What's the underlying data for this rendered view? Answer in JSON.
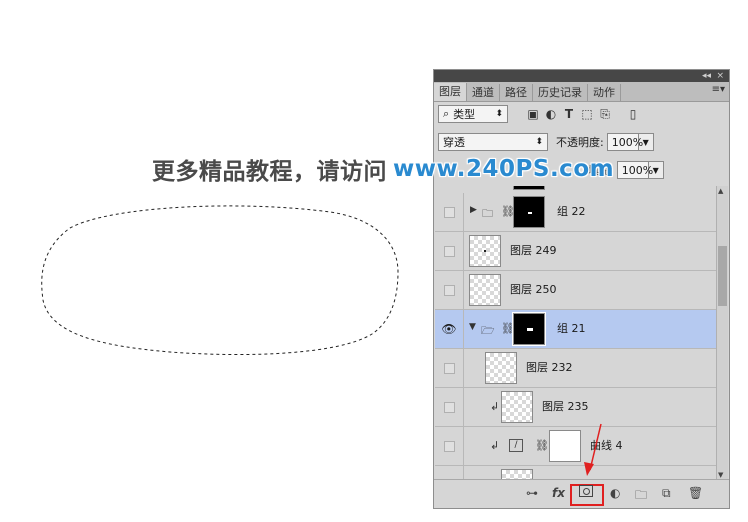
{
  "banner": {
    "text_cn": "更多精品教程，请访问",
    "url": "www.240PS.com"
  },
  "panel": {
    "collapse_icon": "double-chevron-left",
    "close_icon": "close",
    "tabs": [
      "图层",
      "通道",
      "路径",
      "历史记录",
      "动作"
    ],
    "active_tab": "图层",
    "menu_icon": "panel-menu",
    "filter": {
      "value": "类型",
      "search_icon": "search-icon"
    },
    "filter_icons": [
      "image-filter-icon",
      "adjustment-filter-icon",
      "type-filter-icon",
      "shape-filter-icon",
      "smart-object-filter-icon",
      "filter-toggle-icon"
    ],
    "blend_mode": "穿透",
    "opacity_label": "不透明度:",
    "opacity_value": "100%",
    "fill_label": "填充:",
    "fill_value": "100%",
    "layers": [
      {
        "name": "组 22",
        "type": "group",
        "visible": false,
        "expanded": false
      },
      {
        "name": "图层 249",
        "type": "layer",
        "visible": false
      },
      {
        "name": "图层 250",
        "type": "layer",
        "visible": false
      },
      {
        "name": "组 21",
        "type": "group",
        "visible": true,
        "expanded": true,
        "selected": true
      },
      {
        "name": "图层 232",
        "type": "layer",
        "visible": false
      },
      {
        "name": "图层 235",
        "type": "layer",
        "visible": false,
        "clipped": true
      },
      {
        "name": "曲线 4",
        "type": "adjustment",
        "visible": false,
        "clipped": true
      }
    ],
    "bottom_icons": [
      "link-icon",
      "fx-icon",
      "add-mask-icon",
      "adjustment-layer-icon",
      "new-group-icon",
      "new-layer-icon",
      "trash-icon"
    ],
    "highlight_color": "#e02020",
    "selected_row_color": "#b5c9f0"
  }
}
